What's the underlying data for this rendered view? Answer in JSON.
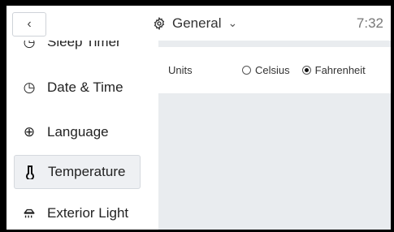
{
  "header": {
    "back_icon": "chevron-left-icon",
    "title": "General",
    "title_icon": "gear-icon",
    "dropdown_icon": "chevron-down-icon",
    "time": "7:32"
  },
  "sidebar": {
    "items": [
      {
        "label": "Sleep Timer",
        "icon": "timer-icon",
        "active": false
      },
      {
        "label": "Date & Time",
        "icon": "clock-icon",
        "active": false
      },
      {
        "label": "Language",
        "icon": "globe-icon",
        "active": false
      },
      {
        "label": "Temperature",
        "icon": "thermometer-icon",
        "active": true
      },
      {
        "label": "Exterior Light",
        "icon": "exterior-light-icon",
        "active": false
      }
    ]
  },
  "settings": {
    "units_label": "Units",
    "options": [
      {
        "label": "Celsius",
        "selected": false
      },
      {
        "label": "Fahrenheit",
        "selected": true
      }
    ]
  },
  "colors": {
    "background": "#ffffff",
    "content_background": "#e9ecef",
    "selected_item": "#eef0f3"
  }
}
